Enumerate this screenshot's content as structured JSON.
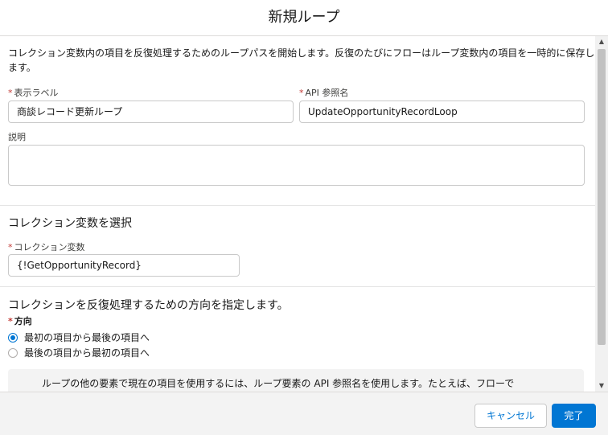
{
  "modal": {
    "title": "新規ループ"
  },
  "description": "コレクション変数内の項目を反復処理するためのループパスを開始します。反復のたびにフローはループ変数内の項目を一時的に保存します。",
  "form": {
    "label_field": {
      "required_mark": "*",
      "label": "表示ラベル",
      "value": "商談レコード更新ループ"
    },
    "api_field": {
      "required_mark": "*",
      "label": "API 参照名",
      "value": "UpdateOpportunityRecordLoop"
    },
    "description_field": {
      "label": "説明",
      "value": ""
    }
  },
  "collection_section": {
    "heading": "コレクション変数を選択",
    "field": {
      "required_mark": "*",
      "label": "コレクション変数",
      "value": "{!GetOpportunityRecord}"
    }
  },
  "direction_section": {
    "heading": "コレクションを反復処理するための方向を指定します。",
    "required_mark": "*",
    "label": "方向",
    "options": [
      {
        "label": "最初の項目から最後の項目へ",
        "checked": true
      },
      {
        "label": "最後の項目から最初の項目へ",
        "checked": false
      }
    ]
  },
  "info": {
    "icon": "info-icon",
    "text": "ループの他の要素で現在の項目を使用するには、ループ要素の API 参照名を使用します。たとえば、フローで"
  },
  "footer": {
    "cancel_label": "キャンセル",
    "done_label": "完了"
  },
  "colors": {
    "brand": "#0176d3",
    "required": "#c23934"
  }
}
